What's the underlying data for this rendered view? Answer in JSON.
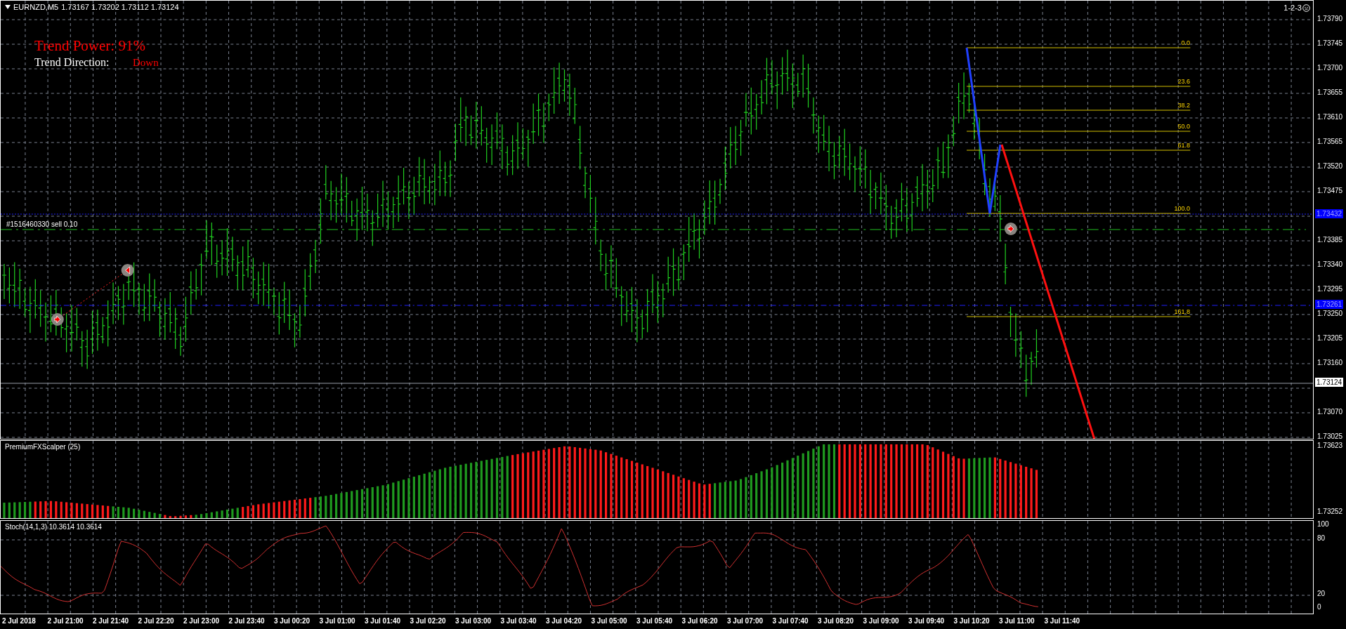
{
  "chart": {
    "symbol": "EURNZD,M5",
    "quote": "1.73167 1.73202 1.73112 1.73124",
    "badge": "1-2-3"
  },
  "overlay": {
    "power_label": "Trend Power: 91%",
    "direction_label": "Trend Direction:",
    "direction": "Down"
  },
  "order_label": "#1516460330 sell 0.10",
  "fib_levels": [
    "0.0",
    "23.6",
    "38.2",
    "50.0",
    "61.8",
    "100.0",
    "161.8"
  ],
  "price_axis": {
    "labels": [
      "1.73790",
      "1.73745",
      "1.73700",
      "1.73655",
      "1.73610",
      "1.73565",
      "1.73520",
      "1.73475",
      "1.73385",
      "1.73340",
      "1.73295",
      "1.73250",
      "1.73205",
      "1.73160",
      "1.73070",
      "1.73025"
    ],
    "markers": [
      {
        "text": "1.73432",
        "kind": "level"
      },
      {
        "text": "1.73261",
        "kind": "level"
      },
      {
        "text": "1.73124",
        "kind": "bid"
      }
    ]
  },
  "indicators": [
    {
      "title": "PremiumFXScalper (25)",
      "axis": [
        "1.73623",
        "1.73252"
      ]
    },
    {
      "title": "Stoch(14,1,3) 10.3614 10.3614",
      "axis": [
        "100",
        "80",
        "20",
        "0"
      ]
    }
  ],
  "time_axis": [
    "2 Jul 2018",
    "2 Jul 21:00",
    "2 Jul 21:40",
    "2 Jul 22:20",
    "2 Jul 23:00",
    "2 Jul 23:40",
    "3 Jul 00:20",
    "3 Jul 01:00",
    "3 Jul 01:40",
    "3 Jul 02:20",
    "3 Jul 03:00",
    "3 Jul 03:40",
    "3 Jul 04:20",
    "3 Jul 05:00",
    "3 Jul 05:40",
    "3 Jul 06:20",
    "3 Jul 07:00",
    "3 Jul 07:40",
    "3 Jul 08:20",
    "3 Jul 09:00",
    "3 Jul 09:40",
    "3 Jul 10:20",
    "3 Jul 11:00",
    "3 Jul 11:40"
  ]
}
